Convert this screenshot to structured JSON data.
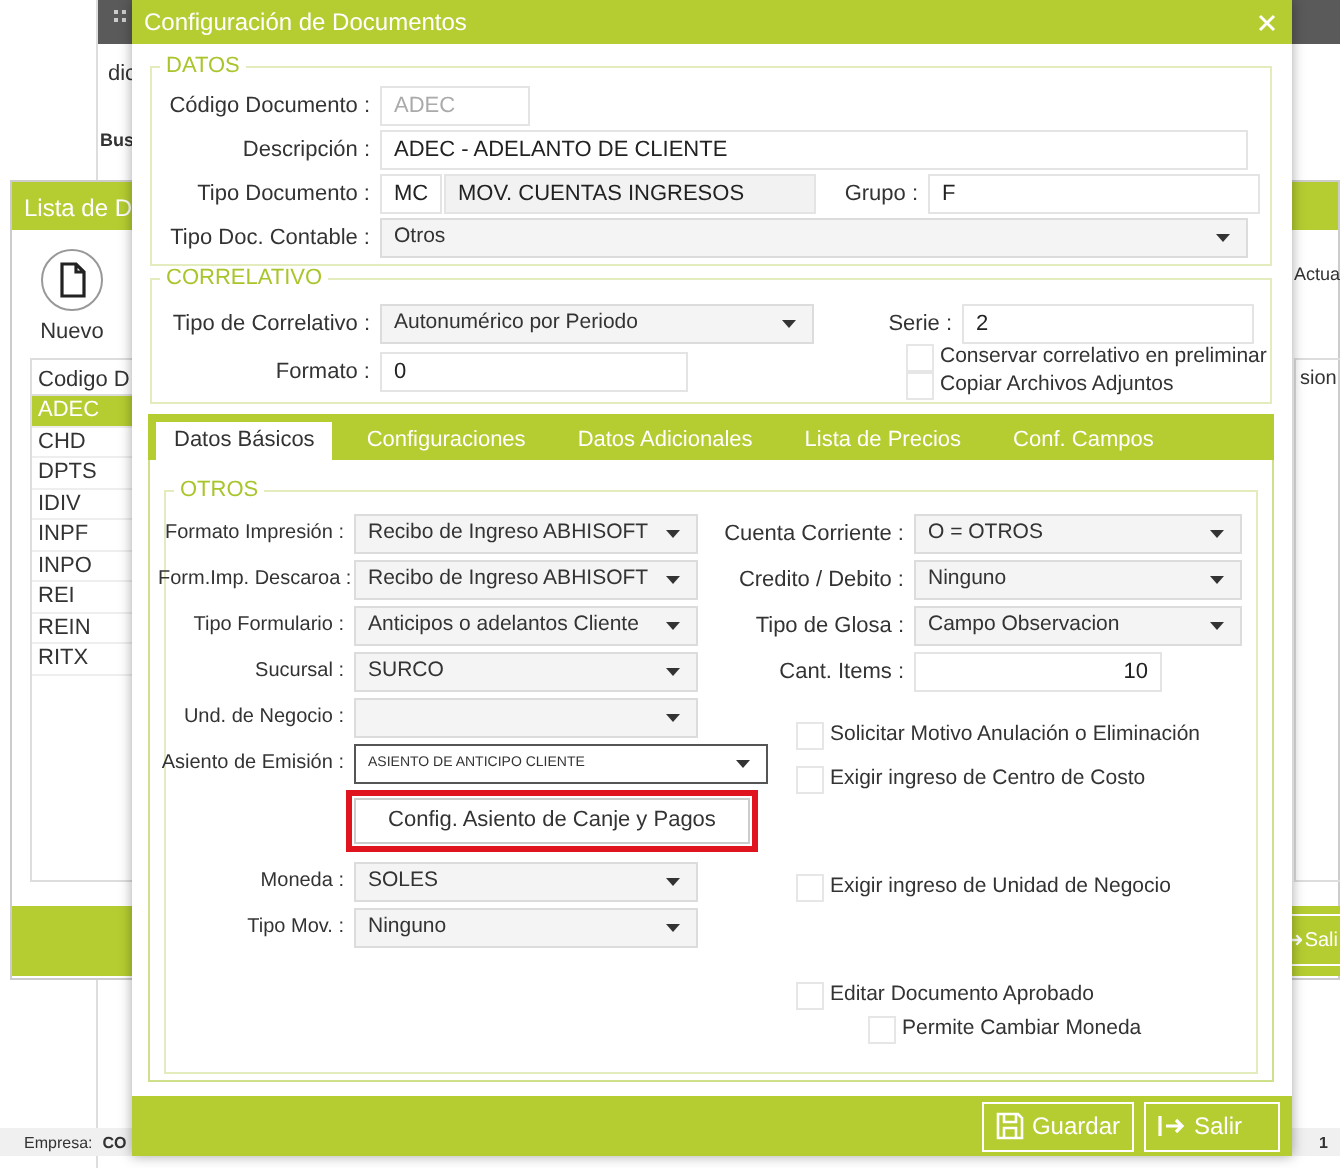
{
  "background": {
    "main_window": {
      "label_1": "dic",
      "label_2": "Bus"
    },
    "list_window": {
      "title": "Lista de D",
      "new_button": "Nuevo",
      "right_label": "Actua",
      "column_1": "Codigo D",
      "column_2": "sion",
      "rows": [
        {
          "code": "ADEC",
          "selected": true
        },
        {
          "code": "CHD",
          "selected": false
        },
        {
          "code": "DPTS",
          "selected": false
        },
        {
          "code": "IDIV",
          "selected": false
        },
        {
          "code": "INPF",
          "selected": false
        },
        {
          "code": "INPO",
          "selected": false
        },
        {
          "code": "REI",
          "selected": false
        },
        {
          "code": "REIN",
          "selected": false
        },
        {
          "code": "RITX",
          "selected": false
        }
      ],
      "exit_button": "Sali"
    },
    "status_bar": {
      "label": "Empresa:",
      "value": "CO",
      "page": "1"
    }
  },
  "dialog": {
    "title": "Configuración de Documentos",
    "datos": {
      "legend": "DATOS",
      "codigo": {
        "label": "Código Documento :",
        "value": "ADEC",
        "disabled": true
      },
      "descripcion": {
        "label": "Descripción :",
        "value": "ADEC - ADELANTO DE CLIENTE",
        "disabled": false
      },
      "tipo_documento": {
        "label": "Tipo Documento :",
        "code": "MC",
        "name": "MOV. CUENTAS INGRESOS"
      },
      "grupo": {
        "label": "Grupo :",
        "value": "F"
      },
      "tipo_doc_contable": {
        "label": "Tipo Doc. Contable :",
        "value": "Otros"
      }
    },
    "correlativo": {
      "legend": "CORRELATIVO",
      "tipo": {
        "label": "Tipo de Correlativo :",
        "value": "Autonumérico por Periodo"
      },
      "serie": {
        "label": "Serie :",
        "value": "2"
      },
      "formato": {
        "label": "Formato :",
        "value": "0"
      },
      "checks": [
        {
          "label": "Conservar correlativo en preliminar",
          "checked": false
        },
        {
          "label": "Copiar Archivos Adjuntos",
          "checked": false
        }
      ]
    },
    "tabs": [
      {
        "label": "Datos Básicos",
        "selected": true
      },
      {
        "label": "Configuraciones",
        "selected": false
      },
      {
        "label": "Datos Adicionales",
        "selected": false
      },
      {
        "label": "Lista de Precios",
        "selected": false
      },
      {
        "label": "Conf. Campos",
        "selected": false
      }
    ],
    "otros": {
      "legend": "OTROS",
      "left": [
        {
          "kind": "select",
          "label": "Formato Impresión :",
          "value": "Recibo de Ingreso ABHISOFT",
          "focused": false
        },
        {
          "kind": "select",
          "label": "Form.Imp. Descaroa :",
          "value": "Recibo de Ingreso ABHISOFT",
          "focused": false
        },
        {
          "kind": "select",
          "label": "Tipo Formulario :",
          "value": "Anticipos o adelantos Cliente",
          "focused": false
        },
        {
          "kind": "select",
          "label": "Sucursal :",
          "value": "SURCO",
          "focused": false
        },
        {
          "kind": "select",
          "label": "Und. de Negocio :",
          "focused": false
        },
        {
          "kind": "select",
          "label": "Asiento de Emisión :",
          "value": "ASIENTO DE ANTICIPO CLIENTE",
          "focused": true
        },
        {
          "kind": "button",
          "label": "Config. Asiento de Canje y Pagos",
          "highlighted": true
        },
        {
          "kind": "select",
          "label": "Moneda :",
          "value": "SOLES",
          "focused": false
        },
        {
          "kind": "select",
          "label": "Tipo Mov. :",
          "value": "Ninguno",
          "focused": false
        }
      ],
      "right": [
        {
          "kind": "select",
          "label": "Cuenta Corriente :",
          "value": "O = OTROS",
          "focused": false
        },
        {
          "kind": "select",
          "label": "Credito / Debito :",
          "value": "Ninguno",
          "focused": false
        },
        {
          "kind": "select",
          "label": "Tipo de Glosa :",
          "value": "Campo Observacion",
          "focused": false
        },
        {
          "kind": "number",
          "label": "Cant. Items :",
          "value": "10"
        },
        {
          "kind": "check",
          "label": "Solicitar Motivo Anulación o Eliminación",
          "checked": false
        },
        {
          "kind": "check",
          "label": "Exigir ingreso de Centro de Costo",
          "checked": false
        },
        {
          "kind": "check",
          "label": "Exigir ingreso de Unidad de Negocio",
          "checked": false
        },
        {
          "kind": "check",
          "label": "Editar Documento Aprobado",
          "checked": false
        },
        {
          "kind": "subcheck",
          "label": "Permite Cambiar Moneda",
          "checked": false
        }
      ]
    },
    "buttons": [
      {
        "kind": "save",
        "label": "Guardar"
      },
      {
        "kind": "exit",
        "label": "Salir"
      }
    ]
  }
}
